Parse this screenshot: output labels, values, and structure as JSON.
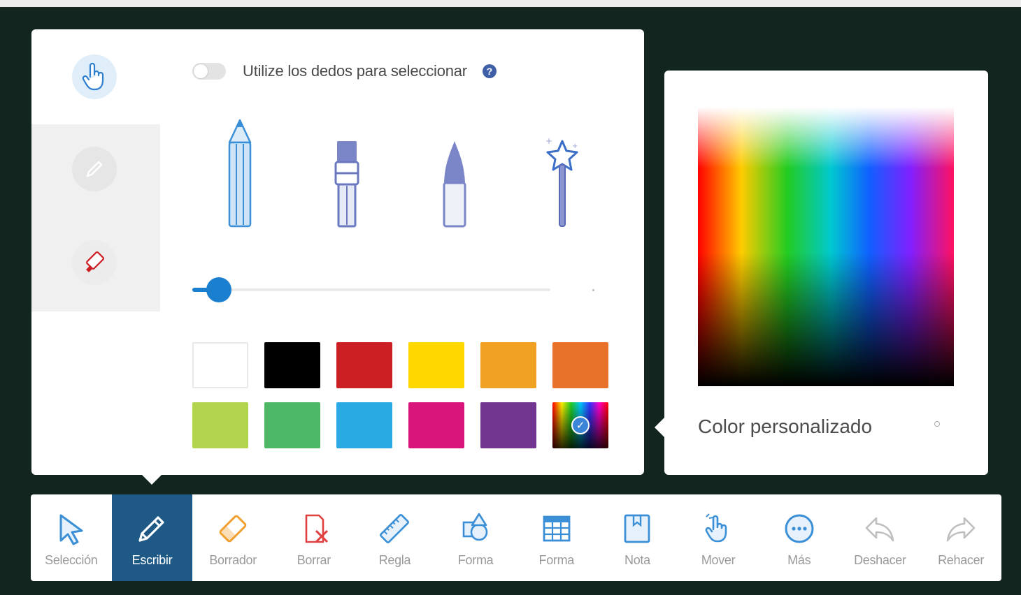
{
  "pen_panel": {
    "finger_select": {
      "label": "Utilize los dedos para seleccionar",
      "enabled": false,
      "help_icon": "?"
    },
    "modes": [
      {
        "name": "touch-mode",
        "icon": "hand-pointer-icon",
        "selected": true
      },
      {
        "name": "pen-mode",
        "icon": "pen-icon",
        "selected": false
      },
      {
        "name": "eraser-mode",
        "icon": "eraser-icon",
        "selected": false
      }
    ],
    "tools": [
      "pencil-icon",
      "marker-icon",
      "brush-icon",
      "magic-wand-icon"
    ],
    "thickness": {
      "value": 0.04
    },
    "colors": [
      [
        "#ffffff",
        "#000000",
        "#cc1f24",
        "#ffd800",
        "#f0a124",
        "#e8722a"
      ],
      [
        "#b3d44f",
        "#4db866",
        "#29aae2",
        "#d9157b",
        "#723590",
        "custom"
      ]
    ],
    "selected_color": "custom"
  },
  "color_panel": {
    "label": "Color personalizado"
  },
  "toolbar": {
    "items": [
      {
        "label": "Selección",
        "icon": "cursor-icon",
        "color": "#3b8fd6"
      },
      {
        "label": "Escribir",
        "icon": "pencil-icon",
        "color": "#ffffff",
        "active": true
      },
      {
        "label": "Borrador",
        "icon": "eraser-icon",
        "color": "#f0a030"
      },
      {
        "label": "Borrar",
        "icon": "clear-page-icon",
        "color": "#e04040"
      },
      {
        "label": "Regla",
        "icon": "ruler-icon",
        "color": "#3b8fd6"
      },
      {
        "label": "Forma",
        "icon": "shapes-icon",
        "color": "#3b8fd6"
      },
      {
        "label": "Forma",
        "icon": "table-icon",
        "color": "#3b8fd6"
      },
      {
        "label": "Nota",
        "icon": "note-icon",
        "color": "#3b8fd6"
      },
      {
        "label": "Mover",
        "icon": "hand-move-icon",
        "color": "#3b8fd6"
      },
      {
        "label": "Más",
        "icon": "more-icon",
        "color": "#3b8fd6"
      },
      {
        "label": "Deshacer",
        "icon": "undo-icon",
        "color": "#bfbfbf"
      },
      {
        "label": "Rehacer",
        "icon": "redo-icon",
        "color": "#bfbfbf"
      }
    ]
  }
}
